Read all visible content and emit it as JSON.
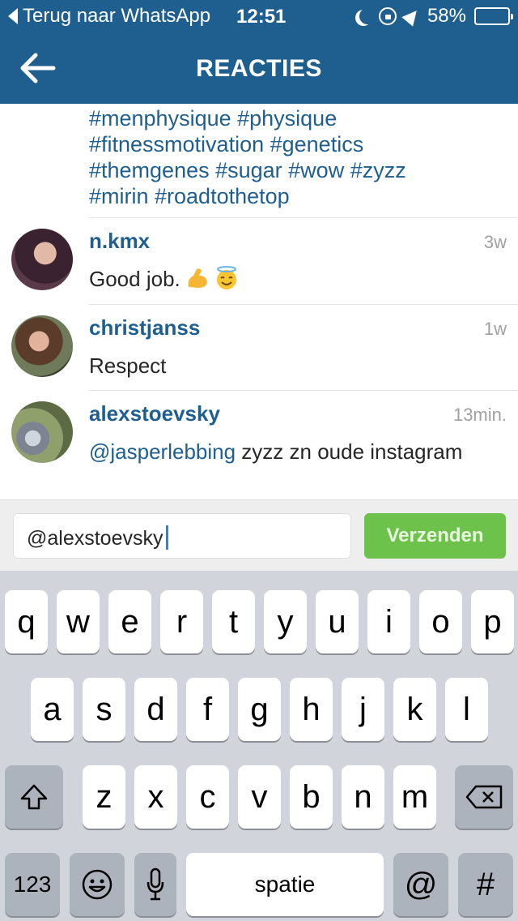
{
  "status_bar": {
    "back_label": "Terug naar WhatsApp",
    "time": "12:51",
    "battery": "58%",
    "battery_level": 0.58,
    "icons": [
      "moon-icon",
      "rotation-lock-icon",
      "location-arrow-icon",
      "battery-icon"
    ]
  },
  "header": {
    "title": "REACTIES",
    "back_icon": "arrow-left-icon"
  },
  "caption": {
    "lines": [
      "#menphysique #physique",
      "#fitnessmotivation #genetics",
      "#themgenes #sugar #wow #zyzz",
      "#mirin #roadtothetop"
    ]
  },
  "comments": [
    {
      "user": "n.kmx",
      "time": "3w",
      "text": "Good job.",
      "emojis": [
        "flexed-biceps-emoji",
        "smiling-face-with-halo-emoji"
      ]
    },
    {
      "user": "christjanss",
      "time": "1w",
      "text": "Respect"
    },
    {
      "user": "alexstoevsky",
      "time": "13min.",
      "mention": "@jasperlebbing",
      "text": " zyzz zn oude instagram"
    }
  ],
  "composer": {
    "value": "@alexstoevsky",
    "send_label": "Verzenden",
    "send_color": "#6cc24a"
  },
  "keyboard": {
    "row1": [
      "q",
      "w",
      "e",
      "r",
      "t",
      "y",
      "u",
      "i",
      "o",
      "p"
    ],
    "row2": [
      "a",
      "s",
      "d",
      "f",
      "g",
      "h",
      "j",
      "k",
      "l"
    ],
    "row3": [
      "z",
      "x",
      "c",
      "v",
      "b",
      "n",
      "m"
    ],
    "numbers_label": "123",
    "space_label": "spatie",
    "at_label": "@",
    "hash_label": "#",
    "icons": [
      "shift-icon",
      "backspace-icon",
      "emoji-icon",
      "microphone-icon"
    ]
  },
  "colors": {
    "header": "#1f5f90",
    "link": "#1f5f90",
    "keyboard_bg": "#d1d4da"
  }
}
